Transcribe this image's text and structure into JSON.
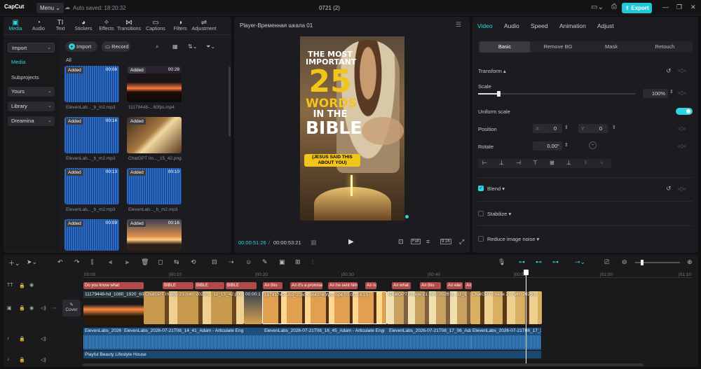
{
  "app": {
    "logo": "CapCut",
    "menu": "Menu",
    "autosave": "Auto saved: 18:20:32",
    "project_title": "0721 (2)",
    "export": "Export"
  },
  "toolbar": [
    {
      "label": "Media",
      "icon": "media-icon",
      "active": true
    },
    {
      "label": "Audio",
      "icon": "audio-icon"
    },
    {
      "label": "Text",
      "icon": "text-icon"
    },
    {
      "label": "Stickers",
      "icon": "stickers-icon"
    },
    {
      "label": "Effects",
      "icon": "effects-icon"
    },
    {
      "label": "Transitions",
      "icon": "transitions-icon"
    },
    {
      "label": "Captions",
      "icon": "captions-icon"
    },
    {
      "label": "Filters",
      "icon": "filters-icon"
    },
    {
      "label": "Adjustment",
      "icon": "adjustment-icon"
    }
  ],
  "sidebar": {
    "import": "Import",
    "media": "Media",
    "subprojects": "Subprojects",
    "yours": "Yours",
    "library": "Library",
    "dreamina": "Dreamina"
  },
  "media": {
    "import_btn": "Import",
    "record_btn": "Record",
    "filter_all": "All",
    "items": [
      {
        "badge": "Added",
        "duration": "00:08",
        "name": "ElevenLab..._b_m2.mp3",
        "type": "audio"
      },
      {
        "badge": "Added",
        "duration": "00:28",
        "name": "11179448-...60fps.mp4",
        "type": "sunset"
      },
      {
        "badge": "Added",
        "duration": "00:14",
        "name": "ElevenLab..._b_m2.mp3",
        "type": "audio"
      },
      {
        "badge": "Added",
        "duration": "",
        "name": "ChatGPT Im..._15_42.png",
        "type": "book"
      },
      {
        "badge": "Added",
        "duration": "00:13",
        "name": "ElevenLab..._b_m2.mp3",
        "type": "audio"
      },
      {
        "badge": "Added",
        "duration": "00:10",
        "name": "ElevenLab..._b_m2.mp3",
        "type": "audio"
      },
      {
        "badge": "Added",
        "duration": "00:09",
        "name": "",
        "type": "audio"
      },
      {
        "badge": "Added",
        "duration": "00:16",
        "name": "",
        "type": "sunset2"
      }
    ]
  },
  "player": {
    "title": "Player-Временная шкала 01",
    "current": "00:00:51:26",
    "total": "00:00:53:21",
    "full_btn": "Full",
    "ratio_btn": "9:16",
    "thumb": {
      "line1": "THE MOST",
      "line2": "IMPORTANT",
      "number": "25",
      "line3": "WORDS",
      "line4": "IN THE",
      "line5": "BIBLE",
      "line6": "(JESUS SAID THIS",
      "line7": "ABOUT YOU)"
    }
  },
  "props": {
    "tabs": [
      "Video",
      "Audio",
      "Speed",
      "Animation",
      "Adjust"
    ],
    "subtabs": [
      "Basic",
      "Remove BG",
      "Mask",
      "Retouch"
    ],
    "transform": "Transform",
    "scale": "Scale",
    "scale_value": "100%",
    "scale_level": 0.13,
    "uniform_scale": "Uniform scale",
    "position": "Position",
    "pos_x_label": "X",
    "pos_x": "0",
    "pos_y_label": "Y",
    "pos_y": "0",
    "rotate": "Rotate",
    "rotate_value": "0.00°",
    "blend": "Blend",
    "stabilize": "Stabilize",
    "reduce_noise": "Reduce image noise"
  },
  "timeline": {
    "ruler": [
      "00:00",
      "|00:10",
      "|00:20",
      "|00:30",
      "|00:40",
      "|00:50",
      "|01:00",
      "|01:10"
    ],
    "cover": "Cover",
    "text_clips": [
      {
        "label": "Do you know what"
      },
      {
        "label": "BIBLE"
      },
      {
        "label": "BIBLE"
      },
      {
        "label": "BIBLE"
      },
      {
        "label": "A≡ this"
      },
      {
        "label": "A≡ it's a promise"
      },
      {
        "label": "A≡ he sent him"
      },
      {
        "label": "A≡ not"
      },
      {
        "label": "A≡ what"
      },
      {
        "label": "A≡ this"
      },
      {
        "label": "A≡ eter"
      },
      {
        "label": "A≡"
      }
    ],
    "video_clips": [
      {
        "label": "11179448-hd_1080_1920_60"
      },
      {
        "label": "ChatGPT Image 21 лип. 2026 р., 11_15_42.png"
      },
      {
        "label": "00:00:1"
      },
      {
        "label": "18741740-uhd_2160_3840_60fps.mp4   00:00:14:15"
      },
      {
        "label": "ChatGPT Image 21 лип. 2026 р., 11_1"
      },
      {
        "label": "ChatGPT Image 21 лип. 2026 р."
      }
    ],
    "audio_clips": [
      {
        "label": "ElevenLabs_2026"
      },
      {
        "label": "ElevenLabs_2026-07-21T08_14_41_Adam - Articulate Eng"
      },
      {
        "label": "ElevenLabs_2026-07-21T08_16_45_Adam - Articulate Engi"
      },
      {
        "label": "ElevenLabs_2026-07-21T08_17_06_Adam - Articulate"
      },
      {
        "label": "ElevenLabs_2026-07-21T08_17_34"
      }
    ],
    "music_clip": "Playful Beauty Lifestyle House"
  },
  "colors": {
    "accent": "#2fd4e0",
    "text_clip": "#b34a4a",
    "audio_clip": "#1d4f7f"
  }
}
